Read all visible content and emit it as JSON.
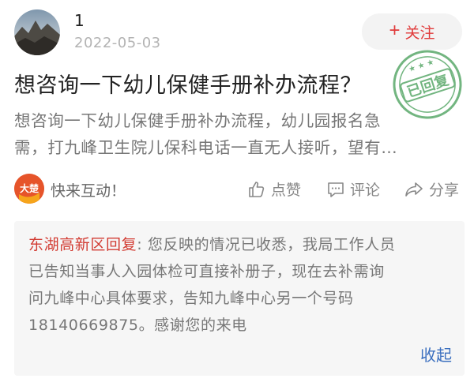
{
  "post": {
    "username": "1",
    "date": "2022-05-03",
    "follow_label": "关注",
    "title": "想咨询一下幼儿保健手册补办流程？",
    "desc_line1": "想咨询一下幼儿保健手册补办流程，幼儿园报名急",
    "desc_line2": "需，打九峰卫生院儿保科电话一直无人接听，望有…",
    "stamp_text": "已回复"
  },
  "source": {
    "label": "快来互动！",
    "logo_text": "大楚"
  },
  "actions": {
    "like_label": "点赞",
    "comment_label": "评论",
    "share_label": "分享"
  },
  "reply": {
    "author": "东湖高新区回复",
    "colon": ":",
    "line1": " 您反映的情况已收悉，我局工作人员",
    "line2": "已告知当事人入园体检可直接补册子，现在去补需询",
    "line3": "问九峰中心具体要求，告知九峰中心另一个号码",
    "line4": "18140669875。感谢您的来电",
    "collapse_label": "收起"
  },
  "colors": {
    "accent_red": "#e03b3b",
    "stamp_green": "#5aa96a",
    "link_blue": "#3b6fbf"
  },
  "icons": [
    "plus-icon",
    "thumb-up-icon",
    "comment-icon",
    "share-icon",
    "replied-stamp-icon"
  ]
}
